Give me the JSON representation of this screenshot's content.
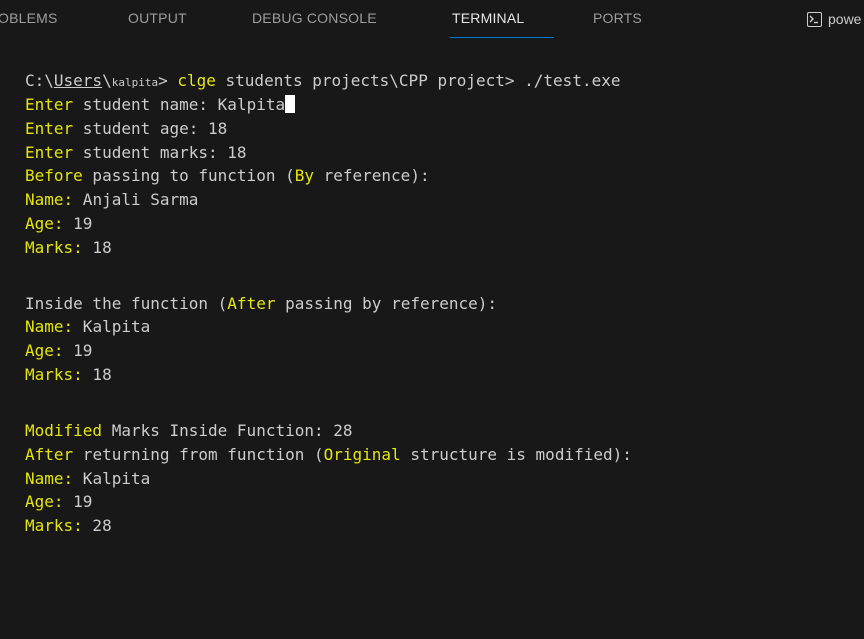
{
  "tabs": {
    "problems": "OBLEMS",
    "output": "OUTPUT",
    "debug_console": "DEBUG CONSOLE",
    "terminal": "TERMINAL",
    "ports": "PORTS"
  },
  "shell": {
    "icon": "terminal-powershell-icon",
    "label": "powe"
  },
  "prompt": {
    "path_drive": "C:\\",
    "path_users": "Users",
    "path_sep": "\\",
    "user": "kalpita",
    "gt": ">",
    "cmd": "clge",
    "rest": "students projects\\CPP project> ./test.exe"
  },
  "input_lines": [
    {
      "label": "Enter",
      "text": " student name: ",
      "value": "Kalpita"
    },
    {
      "label": "Enter",
      "text": " student age: ",
      "value": "18"
    },
    {
      "label": "Enter",
      "text": " student marks: ",
      "value": "18"
    }
  ],
  "before": {
    "heading_keyword": "Before",
    "heading_mid": " passing to function (",
    "heading_keyword2": "By",
    "heading_end": " reference):",
    "name_label": "Name:",
    "name_value": " Anjali Sarma",
    "age_label": "Age:",
    "age_value": " 19",
    "marks_label": "Marks:",
    "marks_value": " 18"
  },
  "inside": {
    "heading_start": "Inside the function (",
    "heading_keyword": "After",
    "heading_end": " passing by reference):",
    "name_label": "Name:",
    "name_value": " Kalpita",
    "age_label": "Age:",
    "age_value": " 19",
    "marks_label": "Marks:",
    "marks_value": " 18"
  },
  "modified": {
    "keyword": "Modified",
    "rest": " Marks Inside Function: 28"
  },
  "after": {
    "heading_keyword": "After",
    "heading_mid": " returning from function (",
    "heading_keyword2": "Original",
    "heading_end": " structure is modified):",
    "name_label": "Name:",
    "name_value": " Kalpita",
    "age_label": "Age:",
    "age_value": " 19",
    "marks_label": "Marks:",
    "marks_value": " 28"
  },
  "colors": {
    "background": "#181818",
    "text": "#cccccc",
    "highlight_yellow": "#e5e510",
    "active_tab_underline": "#0078d4"
  }
}
